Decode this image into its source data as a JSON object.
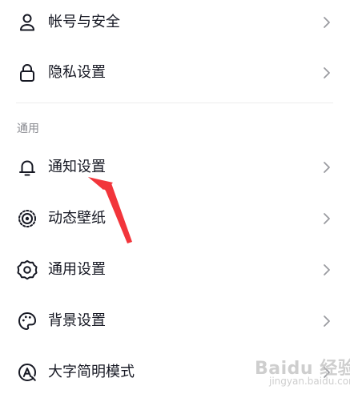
{
  "rows_top": [
    {
      "name": "account-security",
      "label": "帐号与安全",
      "icon": "person-icon"
    },
    {
      "name": "privacy-settings",
      "label": "隐私设置",
      "icon": "lock-icon"
    }
  ],
  "section": {
    "title": "通用"
  },
  "rows_general": [
    {
      "name": "notification-settings",
      "label": "通知设置",
      "icon": "bell-icon"
    },
    {
      "name": "live-wallpaper",
      "label": "动态壁纸",
      "icon": "wallpaper-icon"
    },
    {
      "name": "general-settings",
      "label": "通用设置",
      "icon": "gear-icon"
    },
    {
      "name": "background-settings",
      "label": "背景设置",
      "icon": "palette-icon"
    },
    {
      "name": "large-font-mode",
      "label": "大字简明模式",
      "icon": "font-size-icon"
    }
  ],
  "watermark": {
    "text": "Baidu 经验",
    "sub": "jingyan.baidu.com"
  },
  "colors": {
    "text": "#161823",
    "secondary": "#8a8b91",
    "chevron": "#9a9ba0",
    "annotation_arrow": "#f2353b"
  }
}
